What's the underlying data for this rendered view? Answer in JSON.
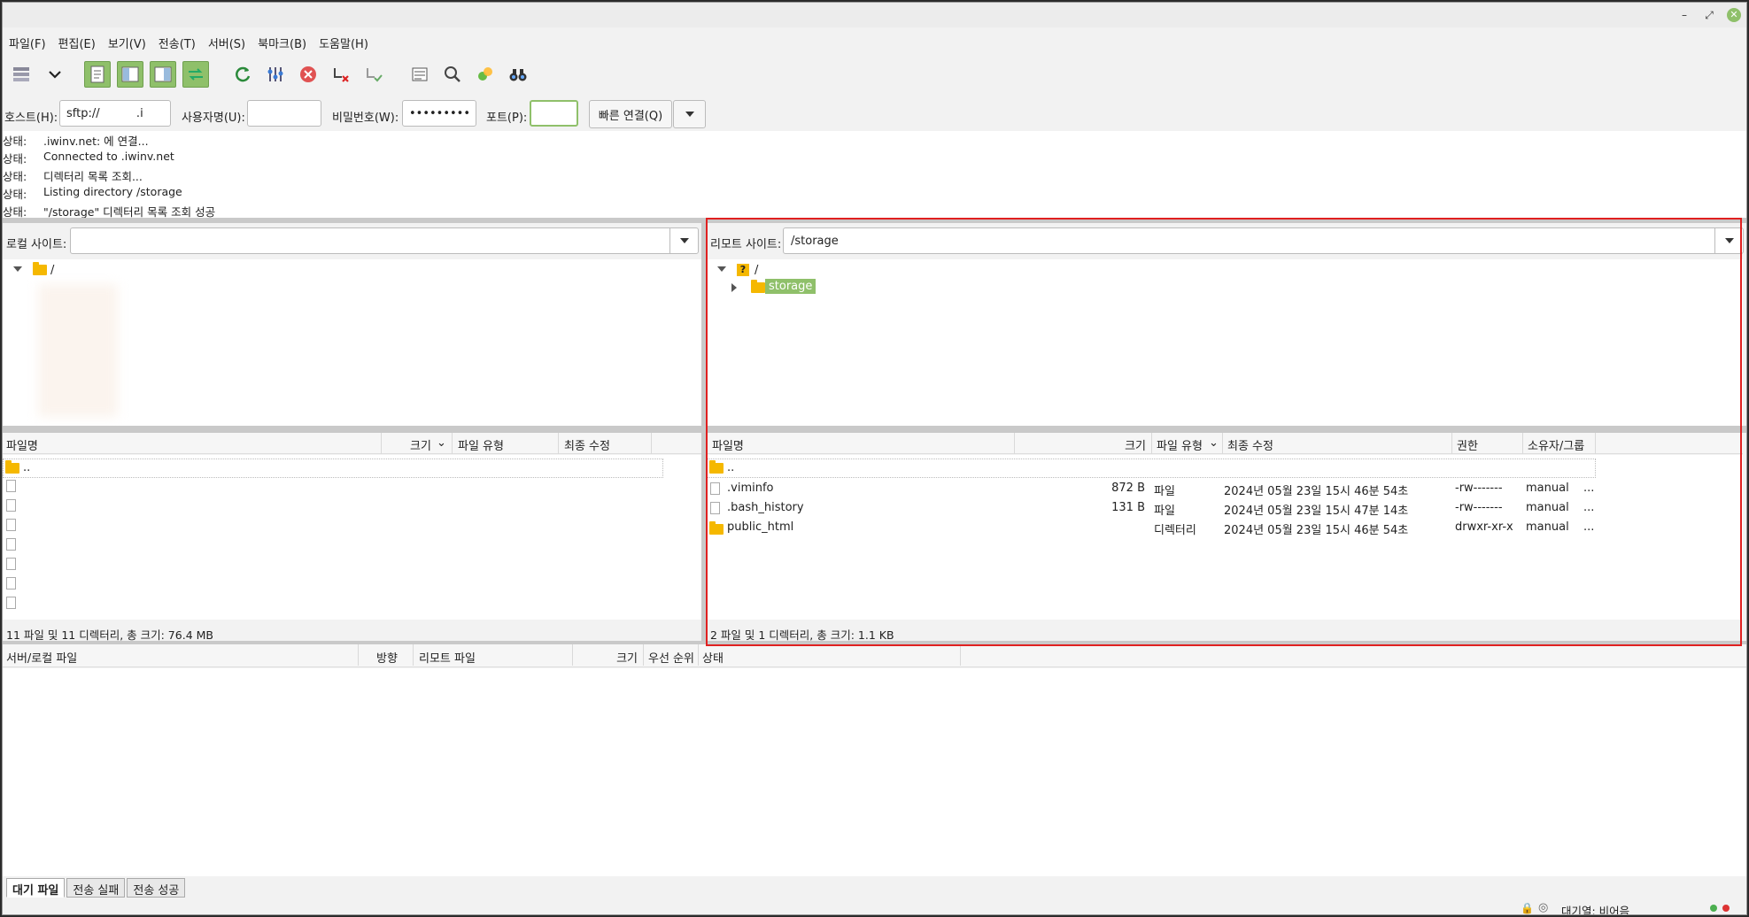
{
  "menu": [
    "파일(F)",
    "편집(E)",
    "보기(V)",
    "전송(T)",
    "서버(S)",
    "북마크(B)",
    "도움말(H)"
  ],
  "quickconnect": {
    "host_label": "호스트(H):",
    "host_value": "sftp://          .i",
    "user_label": "사용자명(U):",
    "user_value": "",
    "pass_label": "비밀번호(W):",
    "pass_value": "•••••••••",
    "port_label": "포트(P):",
    "port_value": "",
    "connect_label": "빠른 연결(Q)"
  },
  "log": [
    {
      "k": "상태:",
      "v": "                .iwinv.net:          에 연결..."
    },
    {
      "k": "상태:",
      "v": "Connected to                 .iwinv.net"
    },
    {
      "k": "상태:",
      "v": "디렉터리 목록 조회..."
    },
    {
      "k": "상태:",
      "v": "Listing directory /storage"
    },
    {
      "k": "상태:",
      "v": "\"/storage\" 디렉터리 목록 조회 성공"
    }
  ],
  "local": {
    "site_label": "로컬 사이트:",
    "site_value": "",
    "tree_root": "/",
    "cols": {
      "name": "파일명",
      "size": "크기",
      "type": "파일 유형",
      "modified": "최종 수정"
    },
    "parent": "..",
    "status": "11 파일 및 11 디렉터리, 총 크기: 76.4 MB"
  },
  "remote": {
    "site_label": "리모트 사이트:",
    "site_value": "/storage",
    "tree_root": "/",
    "tree_child": "storage",
    "cols": {
      "name": "파일명",
      "size": "크기",
      "type": "파일 유형",
      "modified": "최종 수정",
      "perm": "권한",
      "owner": "소유자/그룹"
    },
    "parent": "..",
    "files": [
      {
        "name": ".viminfo",
        "size": "872 B",
        "type": "파일",
        "modified": "2024년 05월 23일 15시 46분 54초",
        "perm": "-rw-------",
        "owner": "manual",
        "more": "..."
      },
      {
        "name": ".bash_history",
        "size": "131 B",
        "type": "파일",
        "modified": "2024년 05월 23일 15시 47분 14초",
        "perm": "-rw-------",
        "owner": "manual",
        "more": "..."
      },
      {
        "name": "public_html",
        "size": "",
        "type": "디렉터리",
        "modified": "2024년 05월 23일 15시 46분 54초",
        "perm": "drwxr-xr-x",
        "owner": "manual",
        "more": "..."
      }
    ],
    "status": "2 파일 및 1 디렉터리, 총 크기: 1.1 KB"
  },
  "queue": {
    "cols": {
      "server_local": "서버/로컬 파일",
      "direction": "방향",
      "remote": "리모트 파일",
      "size": "크기",
      "priority": "우선 순위",
      "status": "상태"
    },
    "tabs": [
      "대기 파일",
      "전송 실패",
      "전송 성공"
    ]
  },
  "statusbar": {
    "queue_text": "대기열: 비어음"
  },
  "colors": {
    "accent_green": "#8fc06a",
    "highlight_red": "#e02020",
    "folder": "#f5b800"
  }
}
